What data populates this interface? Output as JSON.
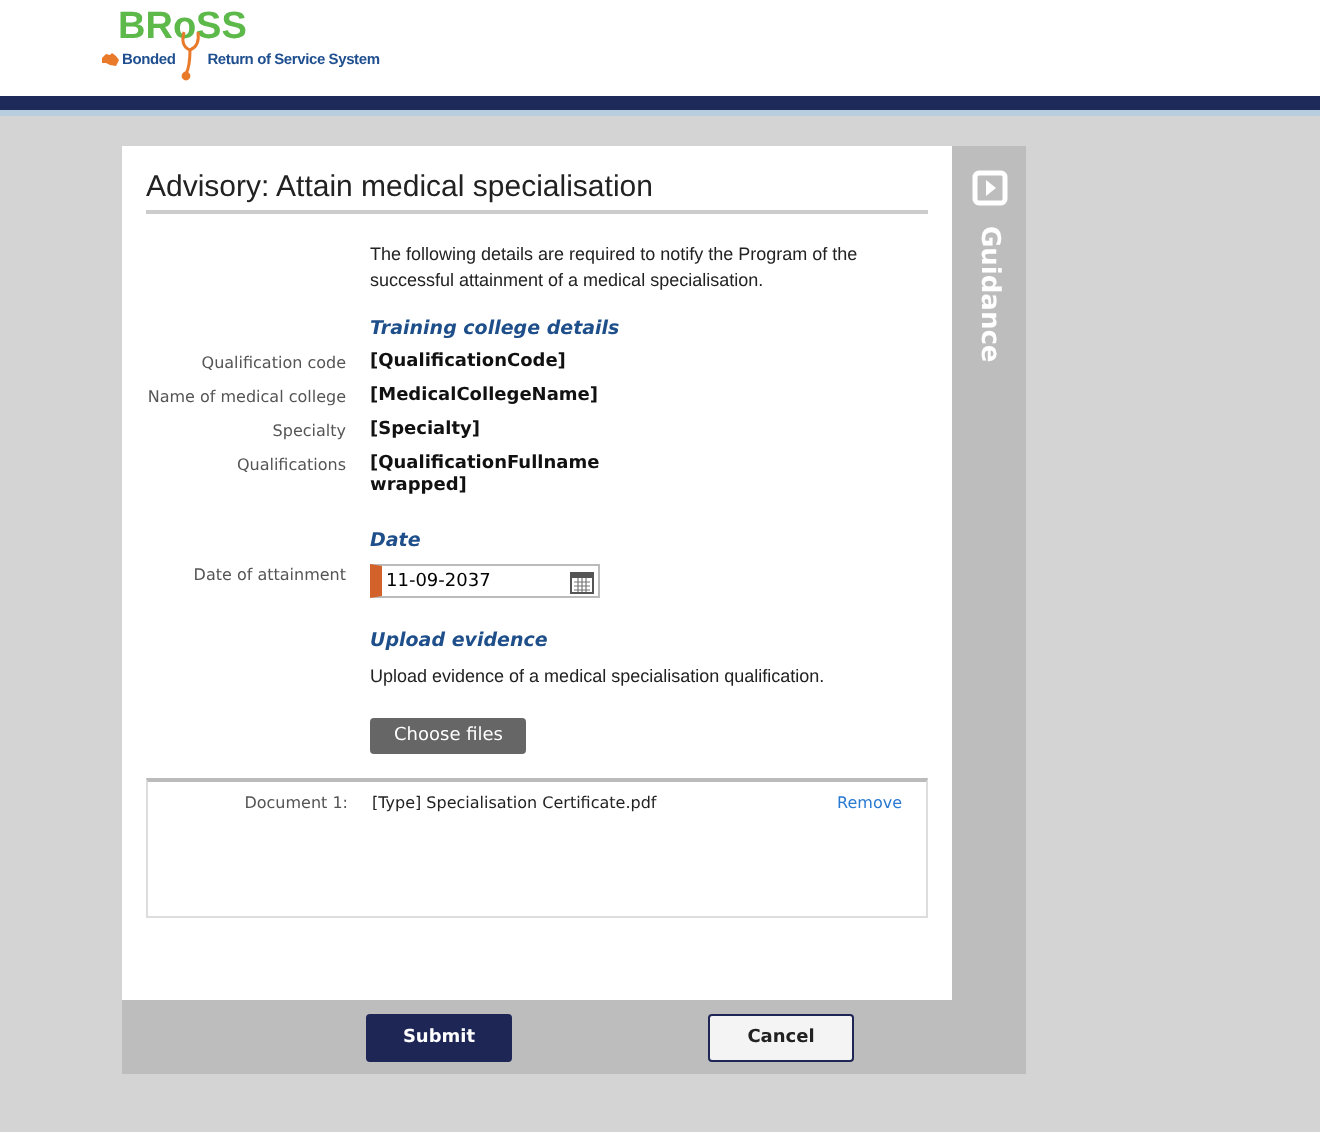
{
  "header": {
    "logo_title": "BRoSS",
    "logo_subtitle_1": "Bonded",
    "logo_subtitle_2": "Return of Service System"
  },
  "dialog": {
    "title": "Advisory: Attain medical specialisation",
    "intro": "The following details are required to notify the Program of the successful attainment of a medical specialisation.",
    "sections": [
      {
        "heading": "Training college details",
        "fields": [
          {
            "kind": "text",
            "label": "Qualification code",
            "value": "[QualificationCode]"
          },
          {
            "kind": "text",
            "label": "Name of medical college",
            "value": "[MedicalCollegeName]"
          },
          {
            "kind": "text",
            "label": "Specialty",
            "value": "[Specialty]"
          },
          {
            "kind": "text",
            "label": "Qualifications",
            "value": "[QualificationFullname wrapped]"
          }
        ]
      },
      {
        "heading": "Date",
        "fields": [
          {
            "kind": "date",
            "label": "Date of attainment",
            "value": "11-09-2037",
            "required": true
          }
        ]
      }
    ],
    "upload": {
      "heading": "Upload evidence",
      "text": "Upload evidence of a medical specialisation qualification.",
      "button": "Choose files",
      "documents": [
        {
          "label": "Document 1:",
          "name": "[Type] Specialisation Certificate.pdf",
          "action": "Remove"
        }
      ]
    },
    "guidance": {
      "label": "Guidance"
    },
    "buttons": [
      {
        "kind": "primary",
        "label": "Submit"
      },
      {
        "kind": "secondary",
        "label": "Cancel"
      }
    ]
  }
}
